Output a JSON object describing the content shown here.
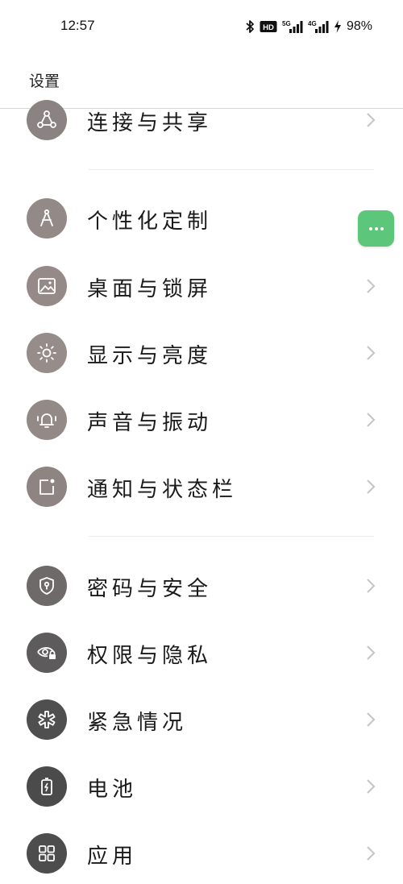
{
  "status": {
    "time": "12:57",
    "battery": "98%",
    "hd_badge": "HD",
    "net1_label": "5G",
    "net2_label": "4G"
  },
  "header": {
    "title": "设置"
  },
  "settings": {
    "items": [
      {
        "label": "连接与共享",
        "icon": "share-nodes-icon"
      },
      {
        "label": "个性化定制",
        "icon": "compass-tool-icon"
      },
      {
        "label": "桌面与锁屏",
        "icon": "image-icon"
      },
      {
        "label": "显示与亮度",
        "icon": "sun-icon"
      },
      {
        "label": "声音与振动",
        "icon": "bell-vibrate-icon"
      },
      {
        "label": "通知与状态栏",
        "icon": "notification-icon"
      },
      {
        "label": "密码与安全",
        "icon": "shield-key-icon"
      },
      {
        "label": "权限与隐私",
        "icon": "eye-lock-icon"
      },
      {
        "label": "紧急情况",
        "icon": "asterisk-icon"
      },
      {
        "label": "电池",
        "icon": "battery-charge-icon"
      },
      {
        "label": "应用",
        "icon": "apps-grid-icon"
      }
    ]
  },
  "colors": {
    "icon_bg_warm": "#8e8583",
    "icon_bg_dark": "#4f4f4f",
    "float_button": "#5cc77a"
  }
}
